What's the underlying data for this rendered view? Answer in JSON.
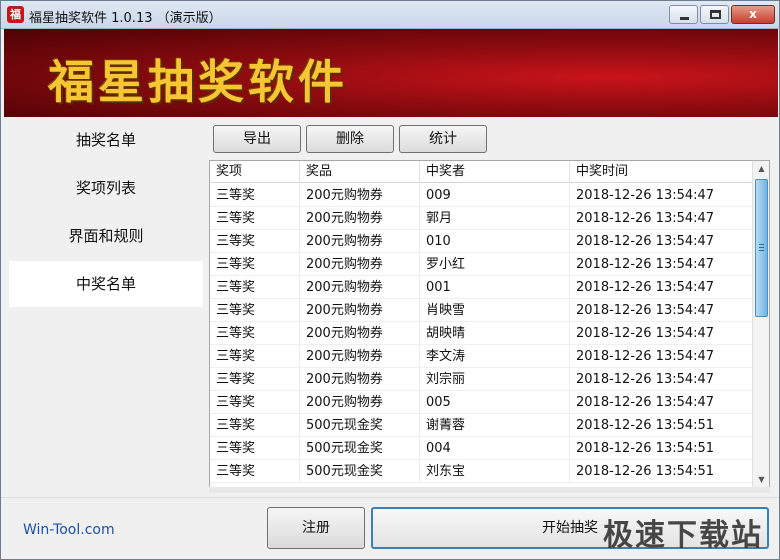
{
  "window": {
    "title": "福星抽奖软件 1.0.13 （演示版）",
    "app_icon_glyph": "福",
    "minimize_glyph": "",
    "close_glyph": "x"
  },
  "banner": {
    "title": "福星抽奖软件"
  },
  "sidebar": {
    "items": [
      {
        "label": "抽奖名单",
        "active": false
      },
      {
        "label": "奖项列表",
        "active": false
      },
      {
        "label": "界面和规则",
        "active": false
      },
      {
        "label": "中奖名单",
        "active": true
      }
    ]
  },
  "toolbar": {
    "export_label": "导出",
    "delete_label": "删除",
    "stats_label": "统计"
  },
  "table": {
    "columns": [
      "奖项",
      "奖品",
      "中奖者",
      "中奖时间"
    ],
    "rows": [
      [
        "三等奖",
        "200元购物券",
        "009",
        "2018-12-26 13:54:47"
      ],
      [
        "三等奖",
        "200元购物券",
        "郭月",
        "2018-12-26 13:54:47"
      ],
      [
        "三等奖",
        "200元购物券",
        "010",
        "2018-12-26 13:54:47"
      ],
      [
        "三等奖",
        "200元购物券",
        "罗小红",
        "2018-12-26 13:54:47"
      ],
      [
        "三等奖",
        "200元购物券",
        "001",
        "2018-12-26 13:54:47"
      ],
      [
        "三等奖",
        "200元购物券",
        "肖映雪",
        "2018-12-26 13:54:47"
      ],
      [
        "三等奖",
        "200元购物券",
        "胡映晴",
        "2018-12-26 13:54:47"
      ],
      [
        "三等奖",
        "200元购物券",
        "李文涛",
        "2018-12-26 13:54:47"
      ],
      [
        "三等奖",
        "200元购物券",
        "刘宗丽",
        "2018-12-26 13:54:47"
      ],
      [
        "三等奖",
        "200元购物券",
        "005",
        "2018-12-26 13:54:47"
      ],
      [
        "三等奖",
        "500元现金奖",
        "谢菁蓉",
        "2018-12-26 13:54:51"
      ],
      [
        "三等奖",
        "500元现金奖",
        "004",
        "2018-12-26 13:54:51"
      ],
      [
        "三等奖",
        "500元现金奖",
        "刘东宝",
        "2018-12-26 13:54:51"
      ]
    ]
  },
  "footer": {
    "brand": "Win-Tool.com",
    "register_label": "注册",
    "start_label": "开始抽奖",
    "watermark": "极速下载站"
  },
  "colors": {
    "banner_red": "#a10d12",
    "banner_text": "#f8c632",
    "brand_blue": "#1d4fa8",
    "scroll_thumb": "#6fb3e3"
  }
}
